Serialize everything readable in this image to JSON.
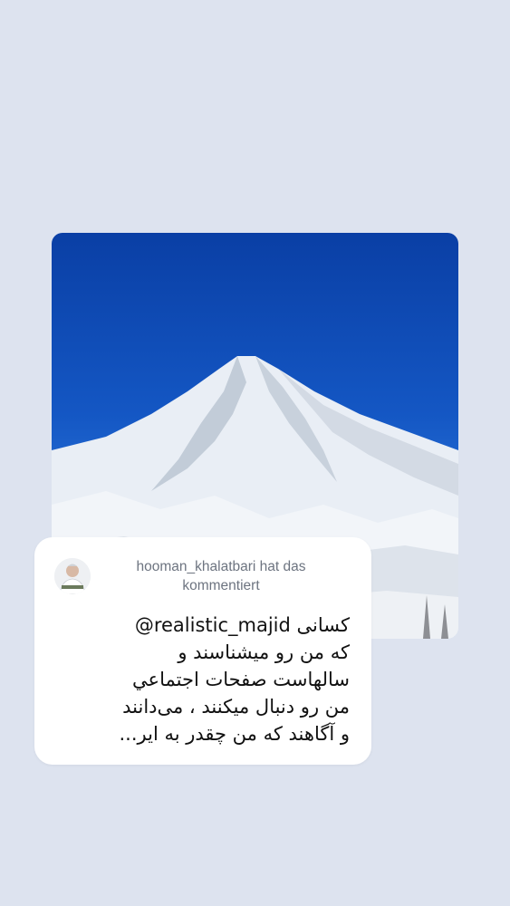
{
  "post": {
    "image_icon": "mountain-photo"
  },
  "comment_card": {
    "avatar_icon": "user-avatar",
    "header_line1": "hooman_khalatbari hat das",
    "header_line2": "kommentiert",
    "mention": "@realistic_majid",
    "line1_rest": "کسانی",
    "line2": "که من رو میشناسند و",
    "line3": "سالهاست صفحات اجتماعي",
    "line4": "من رو دنبال میکنند ، می‌دانند",
    "line5": "و آگاهند که من چقدر به ایر..."
  }
}
